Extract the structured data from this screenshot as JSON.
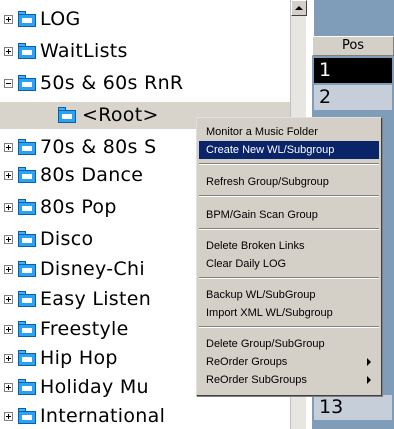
{
  "tree": {
    "items": [
      {
        "label": "LOG",
        "expander": "plus"
      },
      {
        "label": "WaitLists",
        "expander": "plus"
      },
      {
        "label": "50s & 60s RnR",
        "expander": "minus"
      },
      {
        "label": "<Root>",
        "expander": "none",
        "selected": true
      },
      {
        "label": "70s & 80s S",
        "expander": "plus"
      },
      {
        "label": "80s Dance",
        "expander": "plus"
      },
      {
        "label": "80s Pop",
        "expander": "plus"
      },
      {
        "label": "Disco",
        "expander": "plus"
      },
      {
        "label": "Disney-Chi",
        "expander": "plus"
      },
      {
        "label": "Easy Listen",
        "expander": "plus"
      },
      {
        "label": "Freestyle",
        "expander": "plus"
      },
      {
        "label": "Hip Hop",
        "expander": "plus"
      },
      {
        "label": "Holiday Mu",
        "expander": "plus"
      },
      {
        "label": "International",
        "expander": "plus"
      }
    ]
  },
  "grid": {
    "column_header": "Pos",
    "rows": [
      "1",
      "2",
      "13"
    ]
  },
  "context_menu": {
    "items": [
      {
        "label": "Monitor a Music Folder"
      },
      {
        "label": "Create New WL/Subgroup",
        "highlighted": true
      },
      {
        "label": "Refresh Group/Subgroup"
      },
      {
        "label": "BPM/Gain Scan Group"
      },
      {
        "label": "Delete Broken Links"
      },
      {
        "label": "Clear Daily LOG"
      },
      {
        "label": "Backup WL/SubGroup"
      },
      {
        "label": "Import XML WL/Subgroup"
      },
      {
        "label": "Delete Group/SubGroup"
      },
      {
        "label": "ReOrder Groups",
        "submenu": true
      },
      {
        "label": "ReOrder SubGroups",
        "submenu": true
      }
    ]
  },
  "colors": {
    "folder_icon": "#2aa3f4",
    "menu_highlight": "#0a246a",
    "grid_background": "#7f9db9"
  },
  "icons": {
    "folder": "folder-icon",
    "expand": "expand-plus-icon",
    "collapse": "collapse-minus-icon",
    "submenu": "submenu-arrow-icon"
  }
}
